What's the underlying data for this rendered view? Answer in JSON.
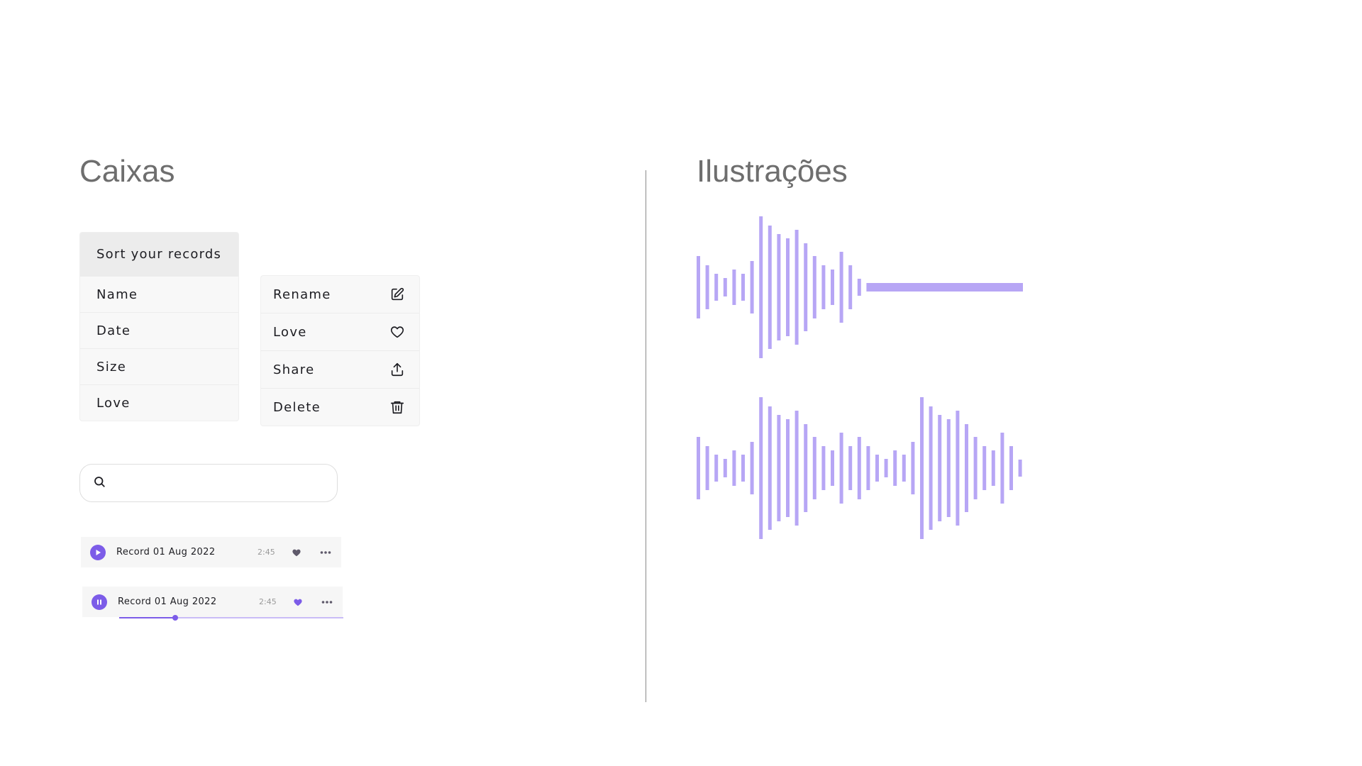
{
  "left_section": {
    "title": "Caixas",
    "sort_box": {
      "header": "Sort your records",
      "items": [
        "Name",
        "Date",
        "Size",
        "Love"
      ]
    },
    "action_box": {
      "items": [
        {
          "label": "Rename",
          "icon": "edit-icon"
        },
        {
          "label": "Love",
          "icon": "heart-outline-icon"
        },
        {
          "label": "Share",
          "icon": "share-upload-icon"
        },
        {
          "label": "Delete",
          "icon": "trash-icon"
        }
      ]
    },
    "search": {
      "value": "",
      "placeholder": "",
      "icon": "search-icon"
    },
    "records": [
      {
        "title": "Record 01 Aug 2022",
        "duration": "2:45",
        "state": "paused",
        "control_icon": "play-icon",
        "heart_color": "#5f5a6b"
      },
      {
        "title": "Record 01 Aug 2022",
        "duration": "2:45",
        "state": "playing",
        "control_icon": "pause-icon",
        "heart_color": "#7c5ce8",
        "progress": 0.25
      }
    ]
  },
  "right_section": {
    "title": "Ilustrações",
    "waveforms": [
      {
        "bar_levels": [
          0.44,
          0.31,
          0.19,
          0.13,
          0.25,
          0.19,
          0.37,
          1.0,
          0.87,
          0.75,
          0.69,
          0.81,
          0.62,
          0.44,
          0.31,
          0.25,
          0.5,
          0.31,
          0.12
        ],
        "flat_line": true
      },
      {
        "bar_levels": [
          0.44,
          0.31,
          0.19,
          0.13,
          0.25,
          0.19,
          0.37,
          1.0,
          0.87,
          0.75,
          0.69,
          0.81,
          0.62,
          0.44,
          0.31,
          0.25,
          0.5,
          0.31,
          0.44,
          0.31,
          0.19,
          0.13,
          0.25,
          0.19,
          0.37,
          1.0,
          0.87,
          0.75,
          0.69,
          0.81,
          0.62,
          0.44,
          0.31,
          0.25,
          0.5,
          0.31,
          0.12
        ],
        "flat_line": false
      }
    ]
  },
  "colors": {
    "accent": "#7c5ce8",
    "wave": "#b7a6f5",
    "muted_heart": "#5f5a6b",
    "title_gray": "#6e6e6e"
  }
}
